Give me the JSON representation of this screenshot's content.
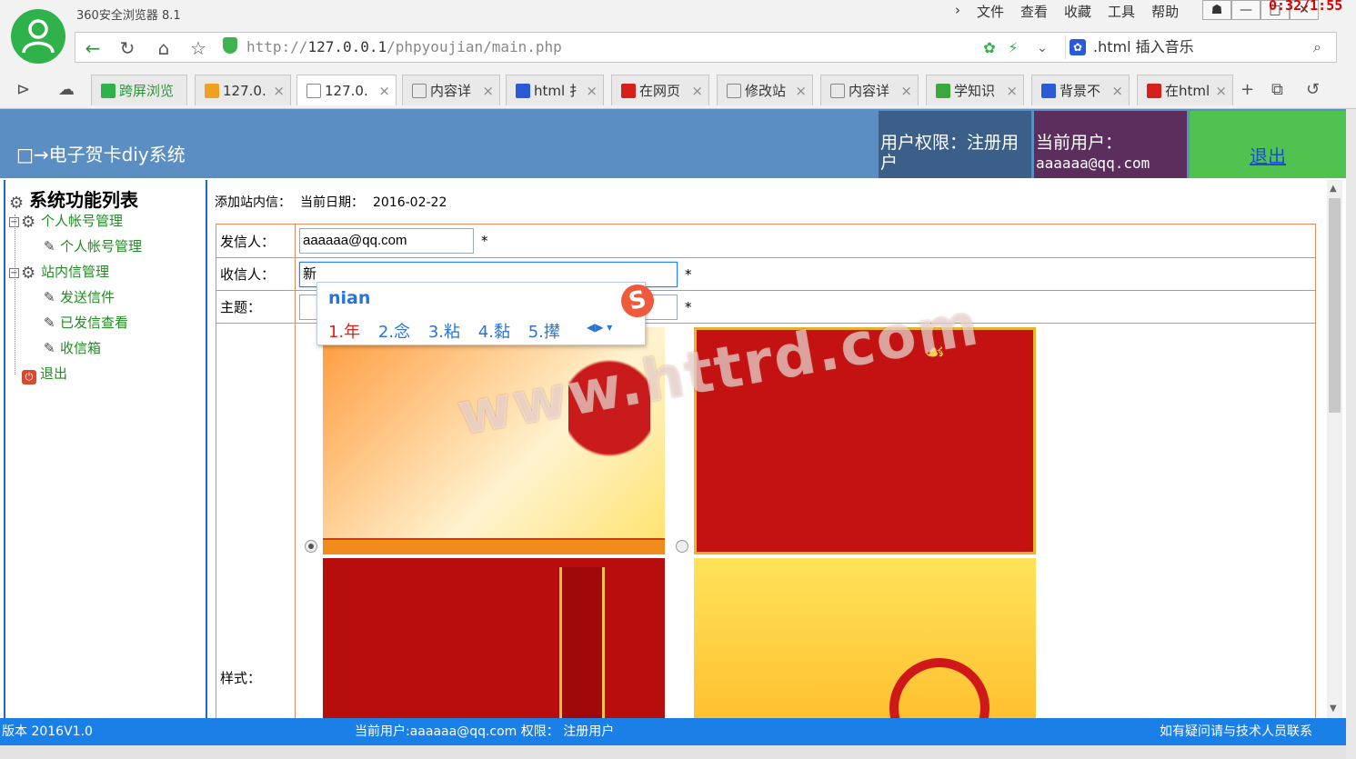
{
  "browser": {
    "app_title": "360安全浏览器 8.1",
    "menus": [
      "文件",
      "查看",
      "收藏",
      "工具",
      "帮助"
    ],
    "clock": "0:32/1:55",
    "address_prefix": "http://",
    "address_host": "127.0.0.1",
    "address_path": "/phpyoujian/main.php",
    "search_text": ".html  插入音乐",
    "tabs": [
      {
        "label": "跨屏浏览",
        "icon": "phone-icon"
      },
      {
        "label": "127.0.",
        "icon": "pma-icon"
      },
      {
        "label": "127.0.",
        "icon": "page-icon",
        "active": true
      },
      {
        "label": "内容详",
        "icon": "page-icon"
      },
      {
        "label": "html 扌",
        "icon": "baidu-paw-icon"
      },
      {
        "label": "在网页",
        "icon": "csdn-icon"
      },
      {
        "label": "修改站",
        "icon": "page-icon"
      },
      {
        "label": "内容详",
        "icon": "page-icon"
      },
      {
        "label": "学知识",
        "icon": "ke-icon"
      },
      {
        "label": "背景不",
        "icon": "baidu-paw-icon"
      },
      {
        "label": "在html",
        "icon": "csdn-icon"
      }
    ]
  },
  "header": {
    "system_name": "□→电子贺卡diy系统",
    "permission": "用户权限：注册用户",
    "current_user_label": "当前用户：",
    "current_user": "aaaaaa@qq.com",
    "logout": "退出"
  },
  "sidebar": {
    "root": "系统功能列表",
    "groups": [
      {
        "label": "个人帐号管理",
        "items": [
          "个人帐号管理"
        ]
      },
      {
        "label": "站内信管理",
        "items": [
          "发送信件",
          "已发信查看",
          "收信箱"
        ]
      }
    ],
    "exit": "退出"
  },
  "content": {
    "crumb_action": "添加站内信：",
    "crumb_date_label": "当前日期：",
    "crumb_date": "2016-02-22",
    "sender_label": "发信人：",
    "sender_value": "aaaaaa@qq.com",
    "receiver_label": "收信人：",
    "receiver_value": "新",
    "subject_label": "主题：",
    "subject_value": "",
    "style_label": "样式：",
    "required_mark": "*",
    "selected_style": 1
  },
  "ime": {
    "pinyin": "nian",
    "candidates": [
      "1.年",
      "2.念",
      "3.粘",
      "4.黏",
      "5.撵"
    ],
    "badge": "S"
  },
  "watermark": "www.httrd.com",
  "footer": {
    "version": "版本 2016V1.0",
    "status": "当前用户:aaaaaa@qq.com 权限： 注册用户",
    "contact": "如有疑问请与技术人员联系"
  },
  "colors": {
    "header_bg": "#5b8fc4",
    "footer_bg": "#1b7fe8",
    "logout_bg": "#4fc24f",
    "user_bg": "#5c2e5e",
    "perm_bg": "#3c5f8a",
    "tree_text": "#228b22",
    "form_border": "#e58a5a"
  }
}
